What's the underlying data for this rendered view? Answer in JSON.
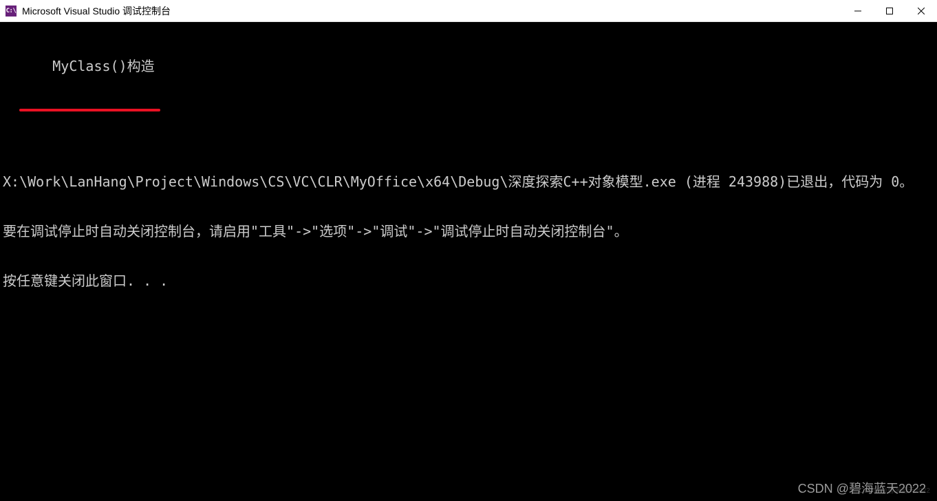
{
  "window": {
    "title": "Microsoft Visual Studio 调试控制台",
    "icon_label": "C:\\"
  },
  "console": {
    "highlighted_output": "MyClass()构造",
    "lines": [
      "X:\\Work\\LanHang\\Project\\Windows\\CS\\VC\\CLR\\MyOffice\\x64\\Debug\\深度探索C++对象模型.exe (进程 243988)已退出，代码为 0。",
      "要在调试停止时自动关闭控制台，请启用\"工具\"->\"选项\"->\"调试\"->\"调试停止时自动关闭控制台\"。",
      "按任意键关闭此窗口. . ."
    ]
  },
  "watermark": {
    "main": "CSDN @碧海蓝天2022",
    "faint": "CSDN @碧海蓝天2022"
  }
}
